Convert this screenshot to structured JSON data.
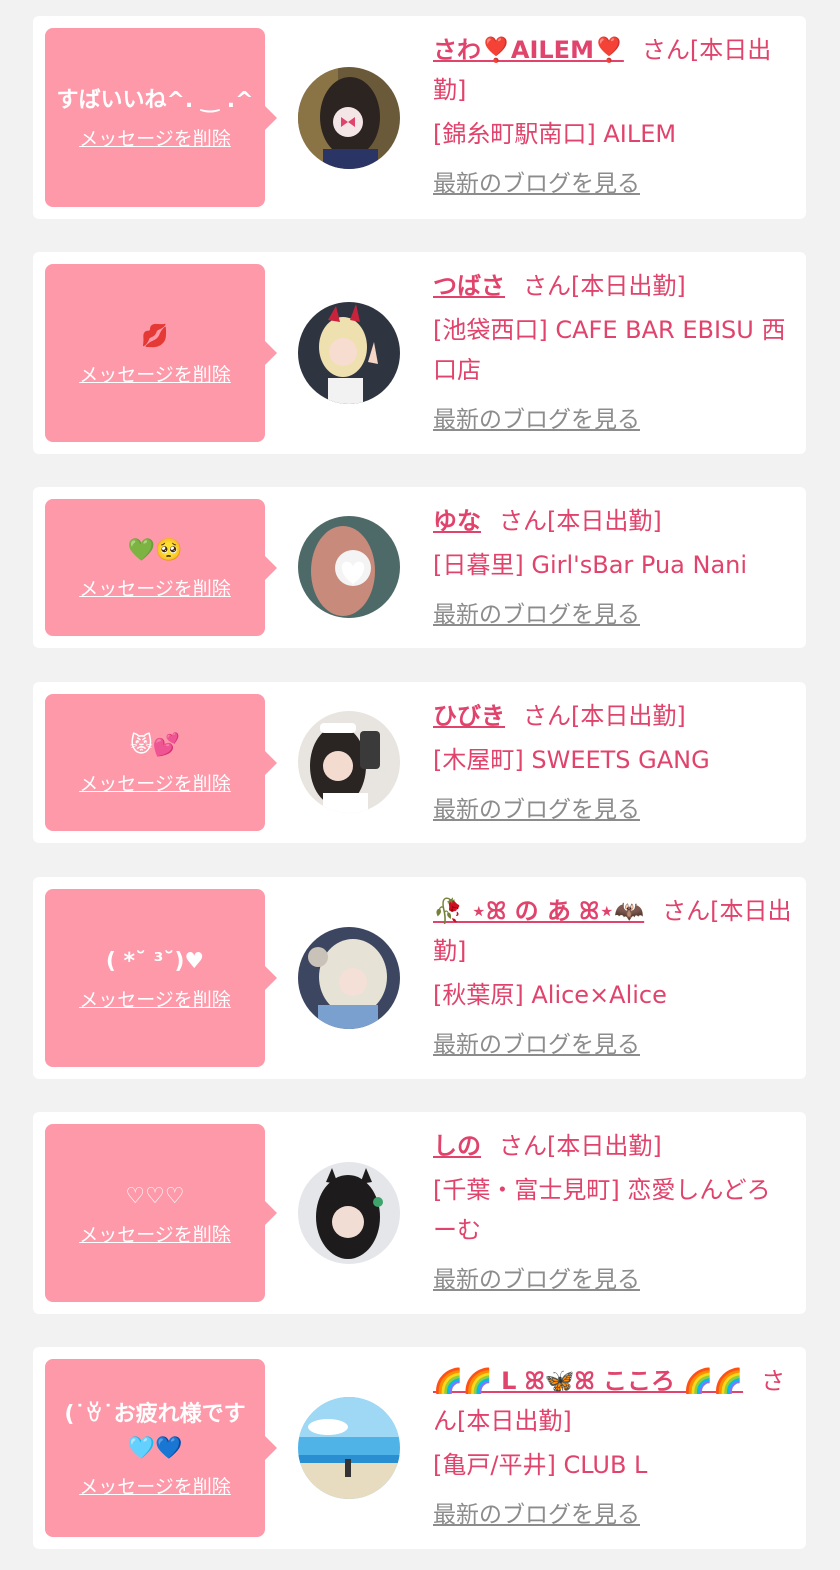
{
  "common": {
    "delete_label": "メッセージを削除",
    "honorific": "さん[本日出勤]",
    "blog_label": "最新のブログを見る"
  },
  "colors": {
    "background": "#f2f2f2",
    "bubble": "#fd99a9",
    "accent": "#e0436b",
    "link_gray": "#8c8c8c"
  },
  "items": [
    {
      "message": "すばいいね^. ‿ .^",
      "name": "さわ❣️AILEM❣️",
      "shop": "[錦糸町駅南口] AILEM"
    },
    {
      "message": "💋",
      "name": "つばさ",
      "shop": "[池袋西口] CAFE BAR EBISU 西口店"
    },
    {
      "message": "💚🥺",
      "name": "ゆな",
      "shop": "[日暮里] Girl'sBar Pua Nani"
    },
    {
      "message": "😾💕",
      "name": "ひびき",
      "shop": "[木屋町] SWEETS GANG"
    },
    {
      "message": "( *˘ ³˘)♥",
      "name": "🥀 ⋆ꕤ の あ ꕤ⋆🦇",
      "shop": "[秋葉原] Alice×Alice"
    },
    {
      "message": "♡♡♡",
      "name": "しの",
      "shop": "[千葉・富士見町] 恋愛しんどろーむ"
    },
    {
      "message": "(˙ꈊ˙お疲れ様です🩵💙",
      "name": "🌈🌈 L ꕤ🦋ꕤ こころ 🌈🌈",
      "shop": "[亀戸/平井] CLUB L"
    }
  ]
}
